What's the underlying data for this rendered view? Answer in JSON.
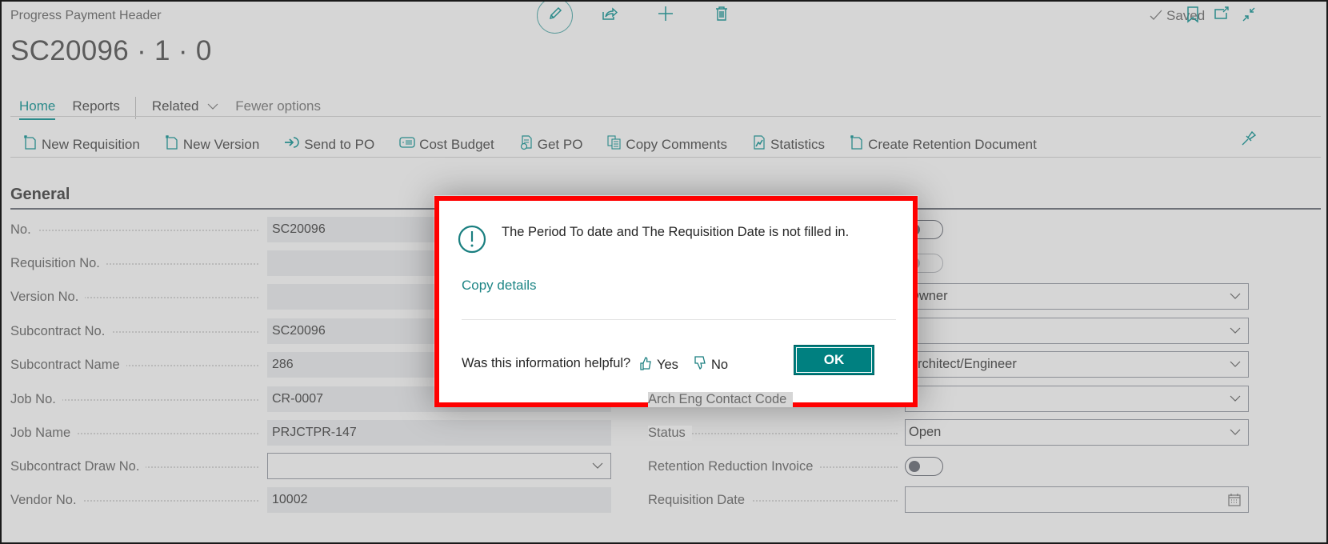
{
  "page": {
    "caption": "Progress Payment Header",
    "title": "SC20096 · 1 · 0",
    "saved_label": "Saved"
  },
  "top_actions": [
    {
      "name": "edit",
      "icon": "pencil-icon"
    },
    {
      "name": "share",
      "icon": "share-icon"
    },
    {
      "name": "new",
      "icon": "plus-icon"
    },
    {
      "name": "delete",
      "icon": "trash-icon"
    }
  ],
  "window_actions": [
    {
      "name": "bookmark",
      "icon": "bookmark-icon"
    },
    {
      "name": "open-new-window",
      "icon": "open-in-new-window-icon"
    },
    {
      "name": "collapse",
      "icon": "collapse-icon"
    }
  ],
  "tabs": [
    {
      "label": "Home",
      "active": true
    },
    {
      "label": "Reports",
      "active": false
    },
    {
      "label": "Related",
      "active": false
    },
    {
      "label": "Fewer options",
      "active": false
    }
  ],
  "toolbar": [
    {
      "label": "New Requisition",
      "icon": "new-document-icon"
    },
    {
      "label": "New Version",
      "icon": "new-document-icon"
    },
    {
      "label": "Send to PO",
      "icon": "send-arrow-icon"
    },
    {
      "label": "Cost Budget",
      "icon": "budget-icon"
    },
    {
      "label": "Get PO",
      "icon": "get-document-icon"
    },
    {
      "label": "Copy Comments",
      "icon": "copy-icon"
    },
    {
      "label": "Statistics",
      "icon": "statistics-icon"
    },
    {
      "label": "Create Retention Document",
      "icon": "new-document-icon"
    }
  ],
  "section": {
    "title": "General"
  },
  "left_fields": [
    {
      "label": "No.",
      "value": "SC20096",
      "type": "readonly"
    },
    {
      "label": "Requisition No.",
      "value": "",
      "type": "readonly"
    },
    {
      "label": "Version No.",
      "value": "",
      "type": "readonly"
    },
    {
      "label": "Subcontract No.",
      "value": "SC20096",
      "type": "readonly"
    },
    {
      "label": "Subcontract Name",
      "value": "286",
      "type": "readonly"
    },
    {
      "label": "Job No.",
      "value": "CR-0007",
      "type": "readonly"
    },
    {
      "label": "Job Name",
      "value": "PRJCTPR-147",
      "type": "readonly"
    },
    {
      "label": "Subcontract Draw No.",
      "value": "",
      "type": "select"
    },
    {
      "label": "Vendor No.",
      "value": "10002",
      "type": "readonly"
    }
  ],
  "right_fields": [
    {
      "label": "",
      "type": "toggle",
      "on": false,
      "disabled": false
    },
    {
      "label": "",
      "type": "toggle",
      "on": false,
      "disabled": true
    },
    {
      "label": "",
      "type": "select",
      "value": "Owner"
    },
    {
      "label": "",
      "type": "select",
      "value": ""
    },
    {
      "label": "",
      "type": "select",
      "value": "Architect/Engineer"
    },
    {
      "label": "Arch Eng Contact Code",
      "type": "select",
      "value": ""
    },
    {
      "label": "Status",
      "type": "select",
      "value": "Open"
    },
    {
      "label": "Retention Reduction Invoice",
      "type": "toggle",
      "on": false,
      "disabled": false
    },
    {
      "label": "Requisition Date",
      "type": "date",
      "value": ""
    }
  ],
  "dialog": {
    "message": "The Period To date and The Requisition Date is not filled in.",
    "copy_details": "Copy details",
    "helpful_question": "Was this information helpful?",
    "yes_label": "Yes",
    "no_label": "No",
    "ok_label": "OK",
    "icon": "warning-circle-icon",
    "accent": "#008080",
    "highlight_border": "#ff0000"
  }
}
